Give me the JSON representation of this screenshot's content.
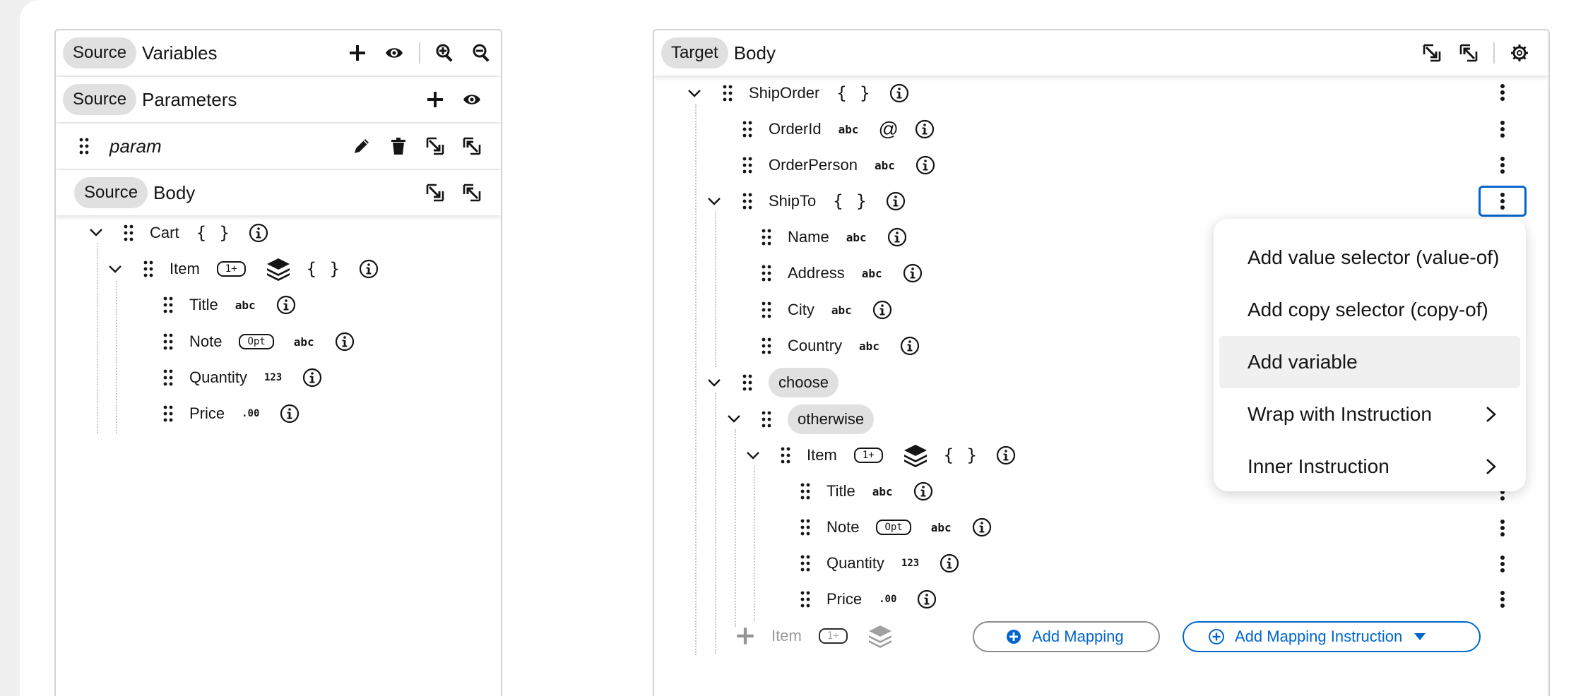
{
  "source": {
    "variables_header": {
      "chip": "Source",
      "title": "Variables"
    },
    "parameters_header": {
      "chip": "Source",
      "title": "Parameters"
    },
    "param_row": {
      "label": "param"
    },
    "body_header": {
      "chip": "Source",
      "title": "Body"
    },
    "tree": {
      "cart": {
        "label": "Cart",
        "type": "{ }"
      },
      "item": {
        "label": "Item",
        "badge": "1+",
        "type": "{ }"
      },
      "fields": [
        {
          "label": "Title",
          "type": "abc"
        },
        {
          "label": "Note",
          "badge": "Opt",
          "type": "abc"
        },
        {
          "label": "Quantity",
          "type": "123"
        },
        {
          "label": "Price",
          "type": ".00"
        }
      ]
    }
  },
  "target": {
    "header": {
      "chip": "Target",
      "title": "Body"
    },
    "shiporder": {
      "label": "ShipOrder",
      "type": "{ }"
    },
    "orderid": {
      "label": "OrderId",
      "type": "abc",
      "attr": "@"
    },
    "orderperson": {
      "label": "OrderPerson",
      "type": "abc"
    },
    "shipto": {
      "label": "ShipTo",
      "type": "{ }"
    },
    "shipto_fields": [
      {
        "label": "Name",
        "type": "abc"
      },
      {
        "label": "Address",
        "type": "abc"
      },
      {
        "label": "City",
        "type": "abc"
      },
      {
        "label": "Country",
        "type": "abc"
      }
    ],
    "choose": {
      "label": "choose"
    },
    "otherwise": {
      "label": "otherwise"
    },
    "item": {
      "label": "Item",
      "badge": "1+",
      "type": "{ }"
    },
    "item_fields": [
      {
        "label": "Title",
        "type": "abc"
      },
      {
        "label": "Note",
        "badge": "Opt",
        "type": "abc"
      },
      {
        "label": "Quantity",
        "type": "123"
      },
      {
        "label": "Price",
        "type": ".00"
      }
    ],
    "ghost_item": {
      "label": "Item",
      "badge": "1+"
    },
    "buttons": {
      "add_mapping": "Add Mapping",
      "add_instruction": "Add Mapping Instruction"
    }
  },
  "context_menu": {
    "items": [
      {
        "label": "Add value selector (value-of)"
      },
      {
        "label": "Add copy selector (copy-of)"
      },
      {
        "label": "Add variable"
      },
      {
        "label": "Wrap with Instruction"
      },
      {
        "label": "Inner Instruction"
      }
    ]
  },
  "colors": {
    "accent": "#0066cc",
    "chip_bg": "#e0e0e0",
    "border": "#d2d2d2"
  },
  "icons": [
    "plus-icon",
    "eye-icon",
    "zoom-in-icon",
    "zoom-out-icon",
    "pencil-icon",
    "trash-icon",
    "collapse-icon",
    "expand-icon",
    "gear-icon",
    "grip-icon",
    "chevron-down-icon",
    "info-icon",
    "layers-icon",
    "kebab-icon",
    "chevron-right-icon",
    "plus-circle-icon",
    "caret-down-icon"
  ]
}
